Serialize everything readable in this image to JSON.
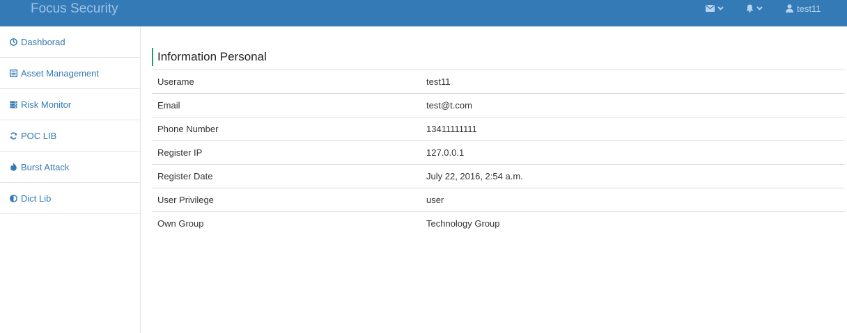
{
  "header": {
    "brand": "Focus Security",
    "icons": {
      "mail": "envelope-icon",
      "bell": "bell-icon",
      "user": "user-icon",
      "caret": "chevron-down-icon"
    },
    "username": "test11",
    "colors": {
      "bar": "#337ab7",
      "brand_text": "#9fc3e6",
      "nav_text": "#b9d3ec"
    }
  },
  "sidebar": {
    "items": [
      {
        "label": "Dashborad",
        "icon": "dashboard-icon"
      },
      {
        "label": "Asset Management",
        "icon": "list-icon"
      },
      {
        "label": "Risk Monitor",
        "icon": "server-icon"
      },
      {
        "label": "POC LIB",
        "icon": "refresh-icon"
      },
      {
        "label": "Burst Attack",
        "icon": "fire-icon"
      },
      {
        "label": "Dict Lib",
        "icon": "adjust-icon"
      }
    ],
    "link_color": "#337ab7"
  },
  "main": {
    "title": "Information Personal",
    "title_accent": "#1aa260",
    "rows": [
      {
        "label": "Userame",
        "value": "test11"
      },
      {
        "label": "Email",
        "value": "test@t.com"
      },
      {
        "label": "Phone Number",
        "value": "13411111111"
      },
      {
        "label": "Register IP",
        "value": "127.0.0.1"
      },
      {
        "label": "Register Date",
        "value": "July 22, 2016, 2:54 a.m."
      },
      {
        "label": "User Privilege",
        "value": "user"
      },
      {
        "label": "Own Group",
        "value": "Technology Group"
      }
    ]
  }
}
